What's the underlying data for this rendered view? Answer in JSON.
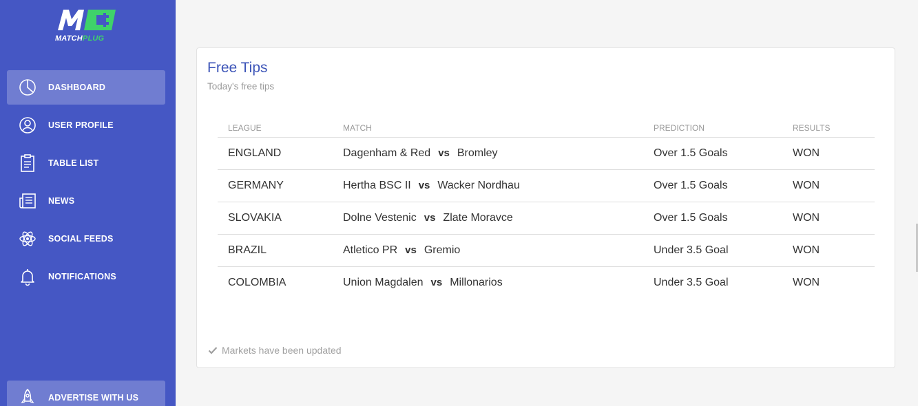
{
  "brand": {
    "logo_text_1": "MATCH",
    "logo_text_2": "PLUG",
    "mark": "M"
  },
  "sidebar": {
    "items": [
      {
        "label": "DASHBOARD",
        "icon": "pie-chart-icon",
        "active": true
      },
      {
        "label": "USER PROFILE",
        "icon": "user-icon"
      },
      {
        "label": "TABLE LIST",
        "icon": "clipboard-icon"
      },
      {
        "label": "NEWS",
        "icon": "newspaper-icon"
      },
      {
        "label": "SOCIAL FEEDS",
        "icon": "atom-icon"
      },
      {
        "label": "NOTIFICATIONS",
        "icon": "bell-icon"
      }
    ],
    "bottom": {
      "label": "ADVERTISE WITH US",
      "icon": "rocket-icon"
    }
  },
  "card": {
    "title": "Free Tips",
    "subtitle": "Today's free tips",
    "columns": [
      "LEAGUE",
      "MATCH",
      "PREDICTION",
      "RESULTS"
    ],
    "vs_label": "vs",
    "rows": [
      {
        "league": "ENGLAND",
        "home": "Dagenham & Red",
        "away": "Bromley",
        "prediction": "Over 1.5 Goals",
        "result": "WON"
      },
      {
        "league": "GERMANY",
        "home": "Hertha BSC II",
        "away": "Wacker Nordhau",
        "prediction": "Over 1.5 Goals",
        "result": "WON"
      },
      {
        "league": "SLOVAKIA",
        "home": "Dolne Vestenic",
        "away": "Zlate Moravce",
        "prediction": "Over 1.5 Goals",
        "result": "WON"
      },
      {
        "league": "BRAZIL",
        "home": "Atletico PR",
        "away": "Gremio",
        "prediction": "Under 3.5 Goal",
        "result": "WON"
      },
      {
        "league": "COLOMBIA",
        "home": "Union Magdalen",
        "away": "Millonarios",
        "prediction": "Under 3.5 Goal",
        "result": "WON"
      }
    ],
    "footer_note": "Markets have been updated"
  },
  "colors": {
    "sidebar": "#4557c4",
    "accent": "#3d55b8",
    "logo_green": "#3fd26a"
  }
}
